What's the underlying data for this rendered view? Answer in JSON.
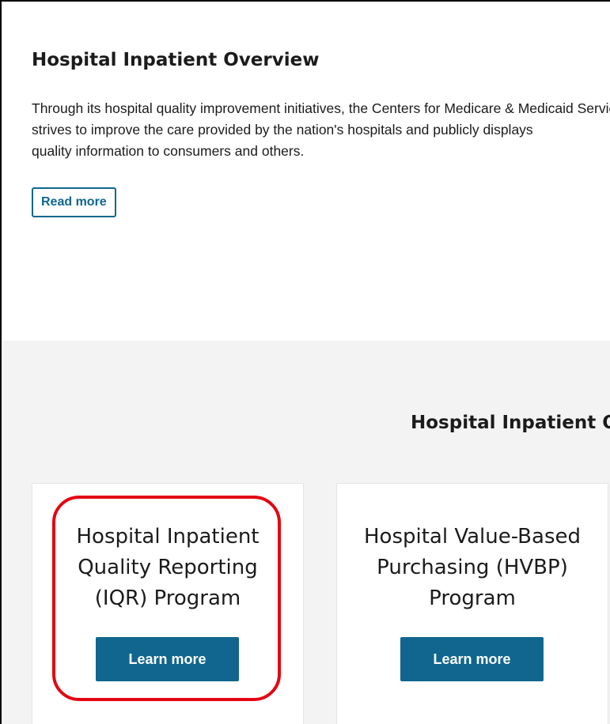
{
  "overview": {
    "title": "Hospital Inpatient Overview",
    "body_lines": [
      "Through its hospital quality improvement initiatives, the Centers for Medicare & Medicaid Services (CMS)",
      "strives to improve the care provided by the nation's hospitals and publicly displays",
      "quality information to consumers and others."
    ],
    "read_more_label": "Read more"
  },
  "programs": {
    "section_title": "Hospital Inpatient Quality Programs",
    "cards": [
      {
        "title_lines": [
          "Hospital Inpatient",
          "Quality Reporting",
          "(IQR) Program"
        ],
        "button_label": "Learn more",
        "highlighted": true
      },
      {
        "title_lines": [
          "Hospital Value-Based",
          "Purchasing (HVBP)",
          "Program"
        ],
        "button_label": "Learn more",
        "highlighted": false
      }
    ]
  },
  "colors": {
    "accent": "#10668e",
    "section_background": "#f3f3f3",
    "highlight_outline": "#e30613"
  }
}
